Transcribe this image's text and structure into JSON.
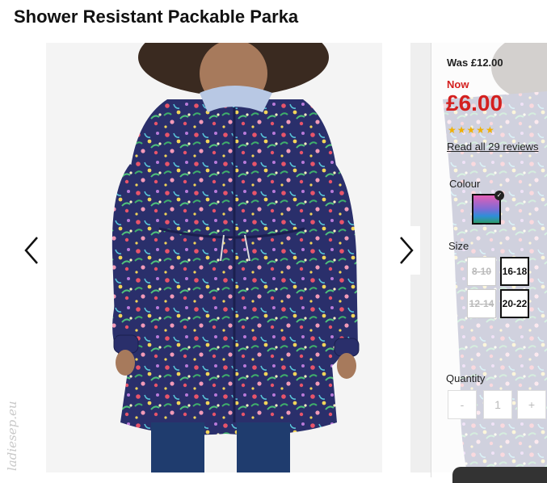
{
  "product": {
    "title": "Shower Resistant Packable Parka",
    "was_price": "Was £12.00",
    "now_label": "Now",
    "price": "£6.00",
    "rating_stars": "★★★★★",
    "rating": 5,
    "reviews_link": "Read all 29 reviews"
  },
  "colour": {
    "label": "Colour",
    "selected_colors": [
      "#e45fb6",
      "#7d6bd6",
      "#2e8fd8",
      "#2e9b6c"
    ]
  },
  "size": {
    "label": "Size",
    "options": [
      {
        "label": "8-10",
        "available": false
      },
      {
        "label": "16-18",
        "available": true
      },
      {
        "label": "12-14",
        "available": false
      },
      {
        "label": "20-22",
        "available": true
      }
    ]
  },
  "quantity": {
    "label": "Quantity",
    "minus": "-",
    "value": "1",
    "plus": "+"
  },
  "gallery": {
    "prev_icon": "chevron-left-icon",
    "next_icon": "chevron-right-icon"
  },
  "watermark": "ladiesep.eu",
  "colors": {
    "price_red": "#d4201f",
    "star_gold": "#f0b000",
    "coat_navy": "#2a2f6b"
  }
}
